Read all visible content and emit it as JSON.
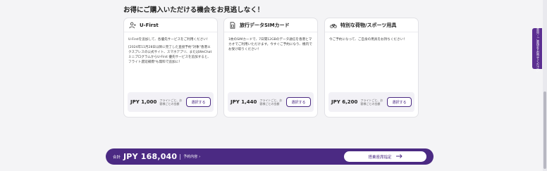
{
  "heading": "お得にご購入いただける機会をお見逃しなく！",
  "cards": [
    {
      "icon": "person-plus-icon",
      "title": "U-First",
      "desc": [
        "U-Firstを追加して、各優先サービスをご利用ください！",
        "[2024年11月28日以降に完了した直接予約\"対象\"香港エクスプレスの公式サイト、スマホアプリ、またはWeChatミニプログラムからU-First 優先サービスを追加すると、フライト遅延補償*も無料で追加に！"
      ],
      "price": "JPY 1,000",
      "note": "フライトごと、お客様ごとの金額",
      "button": "選択する"
    },
    {
      "icon": "sim-card-icon",
      "title": "旅行データSIMカード",
      "desc": [
        "1枚のSIMカードで、7日間12GBのデータ通信を香港とマカオでご利用いただけます。今すぐご予約になり、機内でお受け取りください！"
      ],
      "price": "JPY 1,440",
      "note": "フライトごと、お客様ごとの金額",
      "button": "選択する"
    },
    {
      "icon": "bicycle-icon",
      "title": "特別な荷物/スポーツ用具",
      "desc": [
        "今ご予約になって、ご自身の用具をお持ちください！"
      ],
      "price": "JPY 6,200",
      "note": "フライトごと、お客様ごとの金額",
      "button": "選択する"
    }
  ],
  "bottom_bar": {
    "total_label": "合計",
    "total_value": "JPY 168,040",
    "breakdown_label": "予約内容",
    "cta_label": "搭乗座席指定"
  },
  "side_tab": "ご意見・ご要望をお寄せください",
  "colors": {
    "brand": "#4b2a83",
    "side_tab": "#5b2e91"
  }
}
